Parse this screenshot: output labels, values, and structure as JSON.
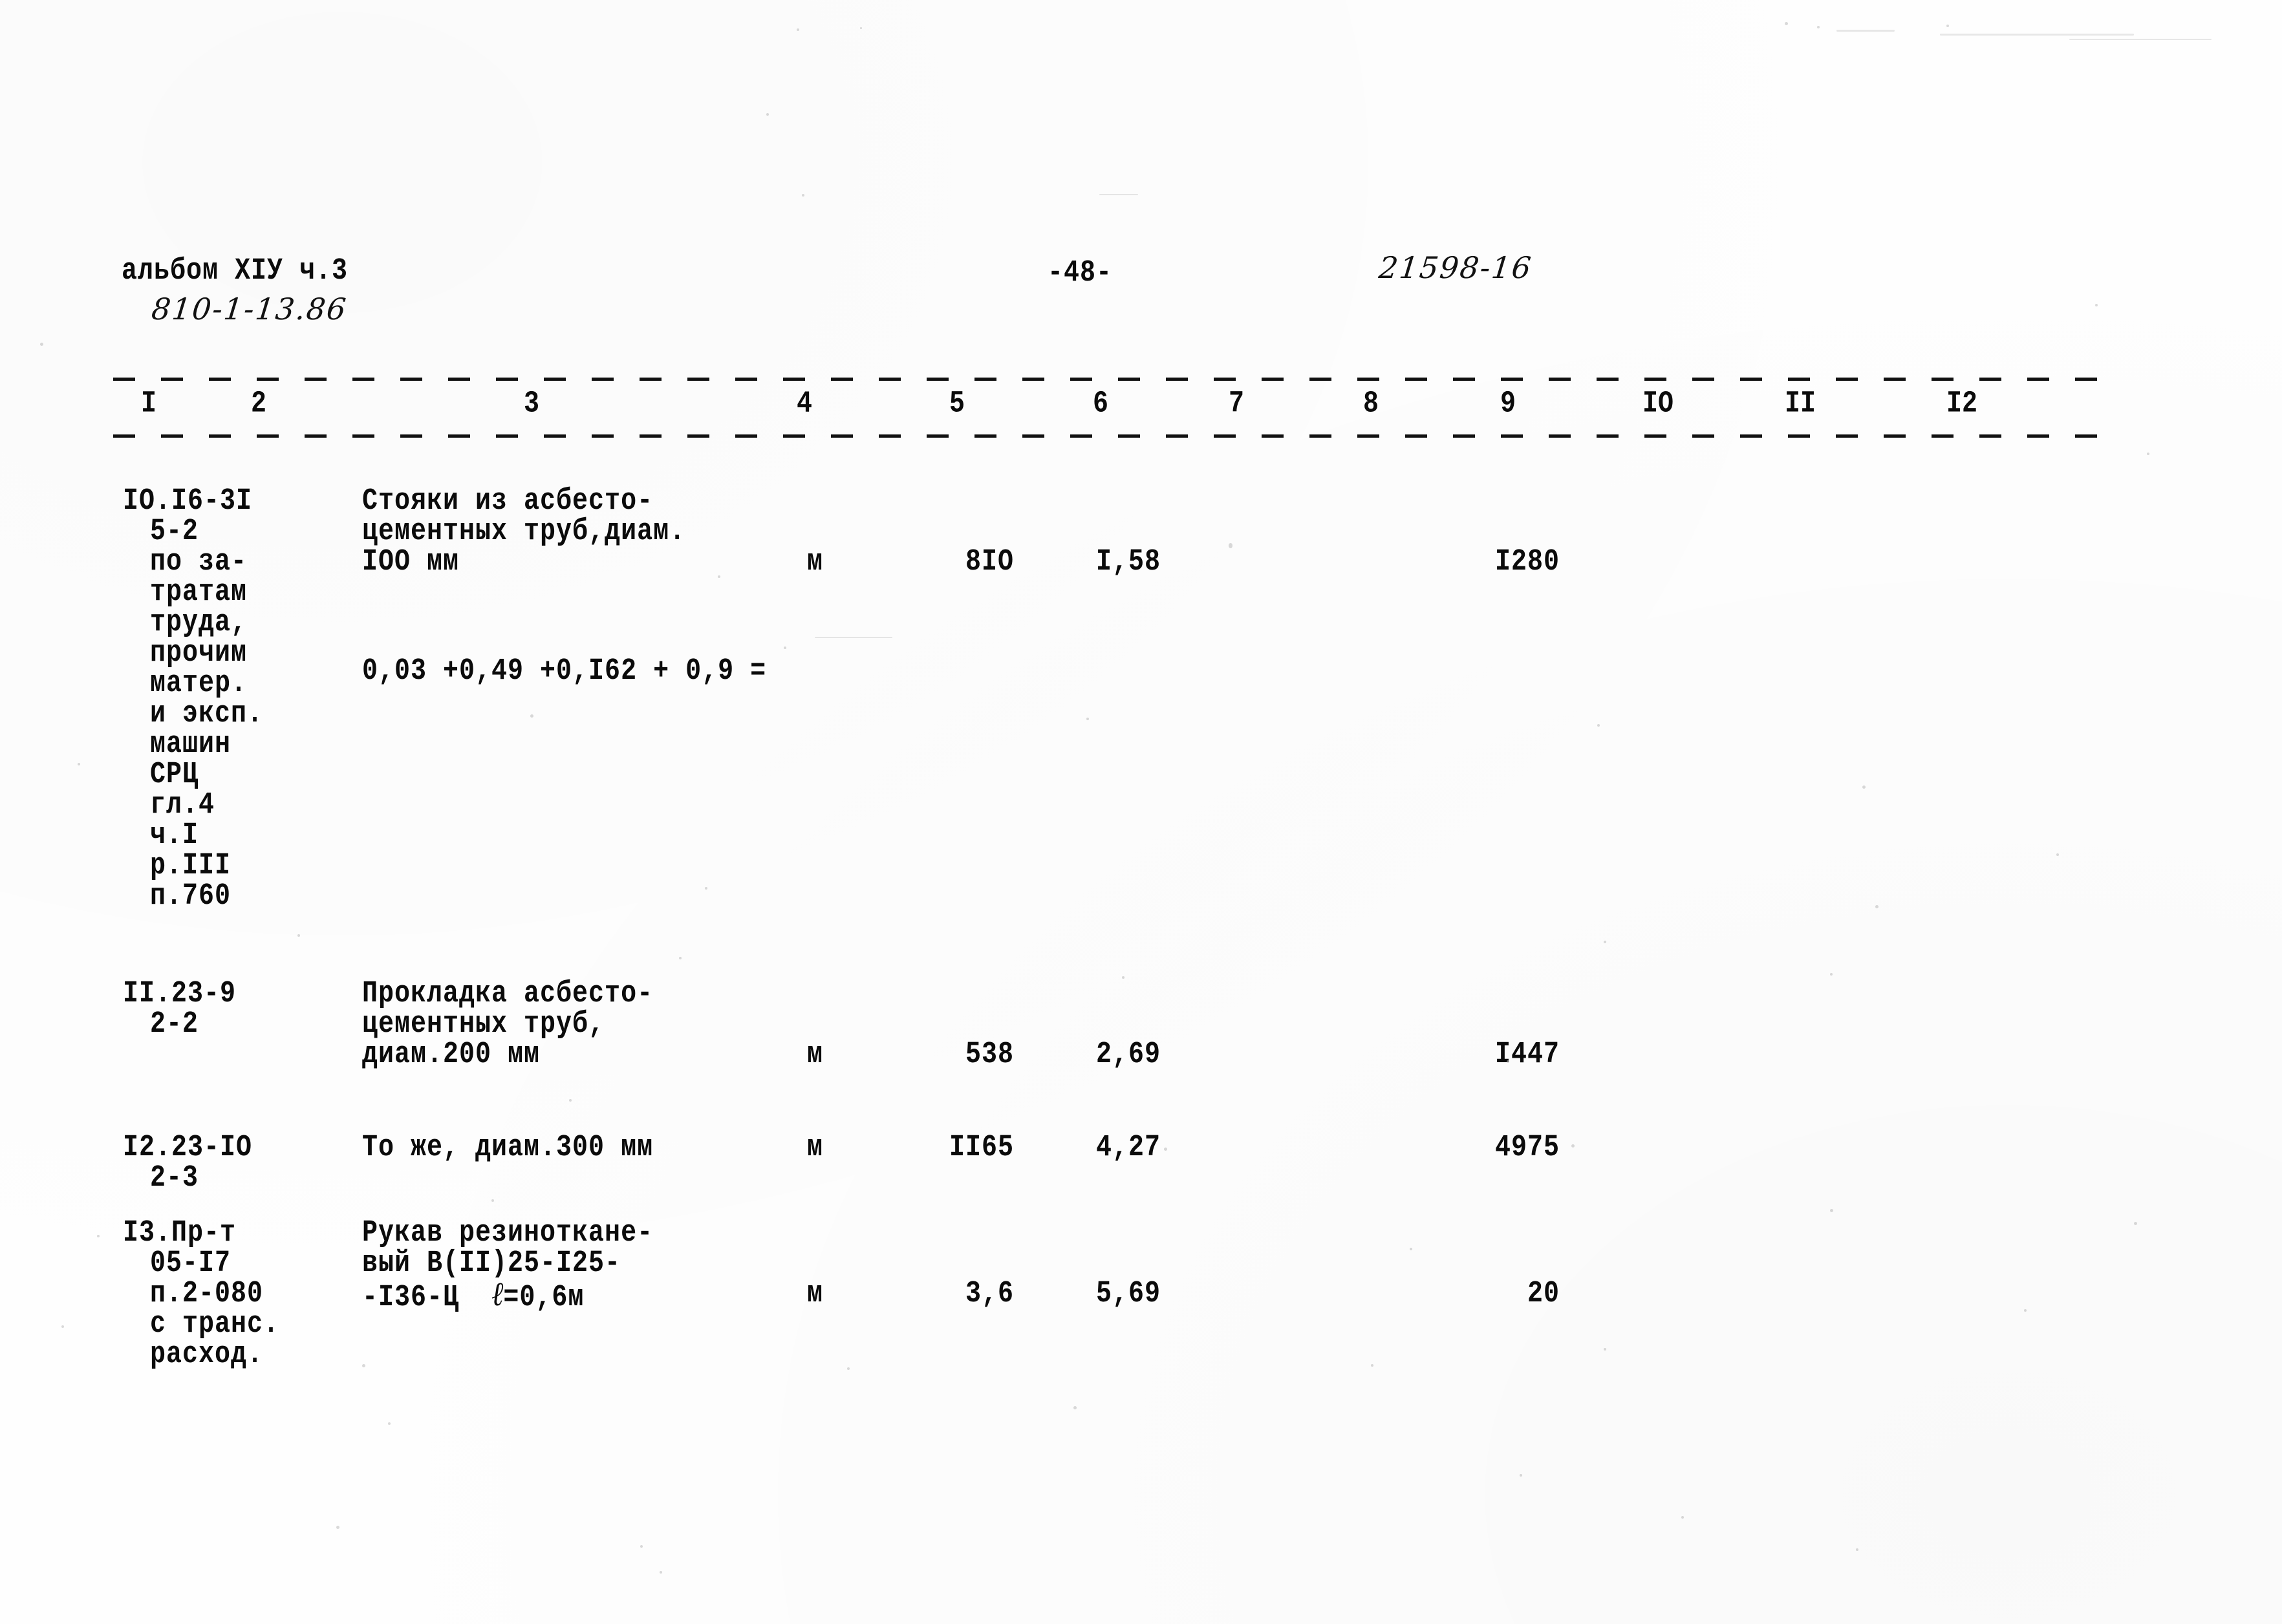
{
  "header": {
    "album_line": "альбом XIУ ч.3",
    "album_code_handwritten": "810-1-13.86",
    "page_number": "-48-",
    "doc_code_handwritten": "21598-16"
  },
  "table": {
    "column_numbers": [
      "I",
      "2",
      "3",
      "4",
      "5",
      "6",
      "7",
      "8",
      "9",
      "IO",
      "II",
      "I2"
    ],
    "rows": [
      {
        "col1_lines": [
          "IO.I6-3I",
          "5-2",
          "по за-",
          "тратам",
          "труда,",
          "прочим",
          "матер.",
          "и эксп.",
          "машин",
          "СРЦ",
          "гл.4",
          "ч.I",
          "р.III",
          "п.760"
        ],
        "col3_lines": [
          "Стояки из асбесто-",
          "цементных труб,диам.",
          "IOO мм"
        ],
        "col3_formula": "0,03 +0,49 +0,I62 + 0,9 =",
        "col4": "м",
        "col5": "8IO",
        "col6": "I,58",
        "col9": "I280"
      },
      {
        "col1_lines": [
          "II.23-9",
          "2-2"
        ],
        "col3_lines": [
          "Прокладка асбесто-",
          "цементных труб,",
          "диам.200 мм"
        ],
        "col4": "м",
        "col5": "538",
        "col6": "2,69",
        "col9": "I447"
      },
      {
        "col1_lines": [
          "I2.23-IO",
          "2-3"
        ],
        "col3_lines": [
          "То же, диам.300 мм"
        ],
        "col4": "м",
        "col5": "II65",
        "col6": "4,27",
        "col9": "4975"
      },
      {
        "col1_lines": [
          "I3.Пр-т",
          "05-I7",
          "п.2-080",
          "с транс.",
          "расход."
        ],
        "col3_lines": [
          "Рукав резиноткане-",
          "вый В(II)25-I25-"
        ],
        "col3_tail_prefix": "-I36-Ц  ",
        "col3_tail_ell": "ℓ",
        "col3_tail_suffix": "=0,6м",
        "col4": "м",
        "col5": "3,6",
        "col6": "5,69",
        "col9": "20"
      }
    ]
  }
}
